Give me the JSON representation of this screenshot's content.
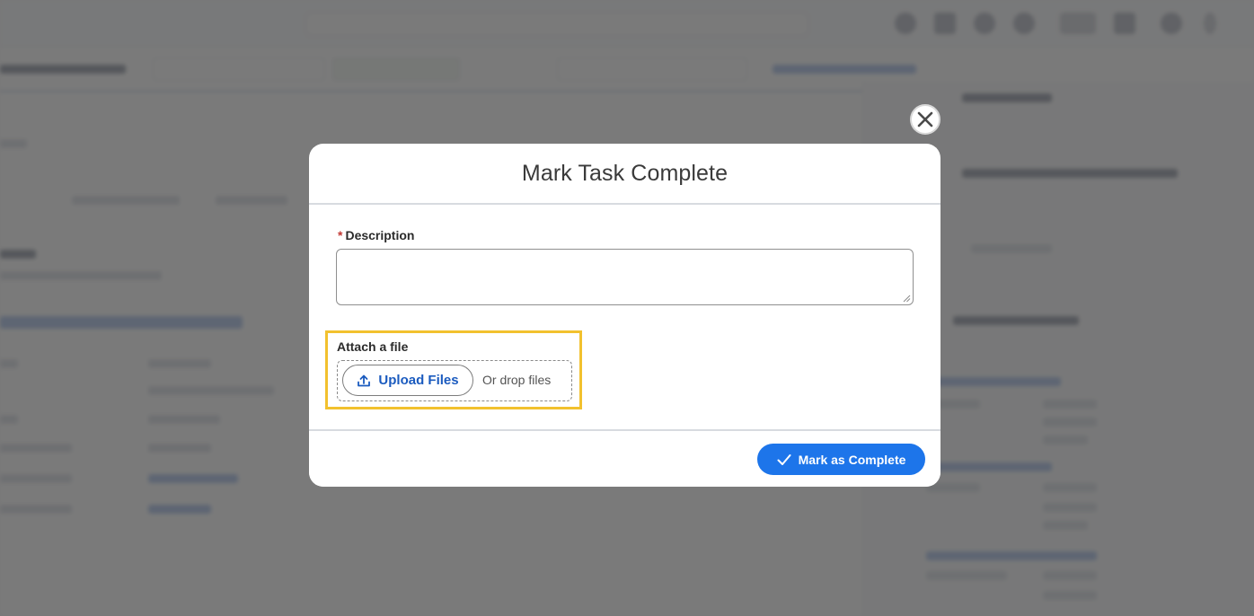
{
  "modal": {
    "title": "Mark Task Complete",
    "description_label": "Description",
    "required_marker": "*",
    "description_value": "",
    "attach_label": "Attach a file",
    "upload_button_label": "Upload Files",
    "drop_text": "Or drop files",
    "complete_button_label": "Mark as Complete",
    "close_icon": "close-icon",
    "upload_icon": "upload-icon",
    "check_icon": "check-icon"
  },
  "colors": {
    "primary_button": "#1d75ea",
    "upload_label": "#1b5bbf",
    "highlight_border": "#f2c12e",
    "required": "#c23934"
  }
}
